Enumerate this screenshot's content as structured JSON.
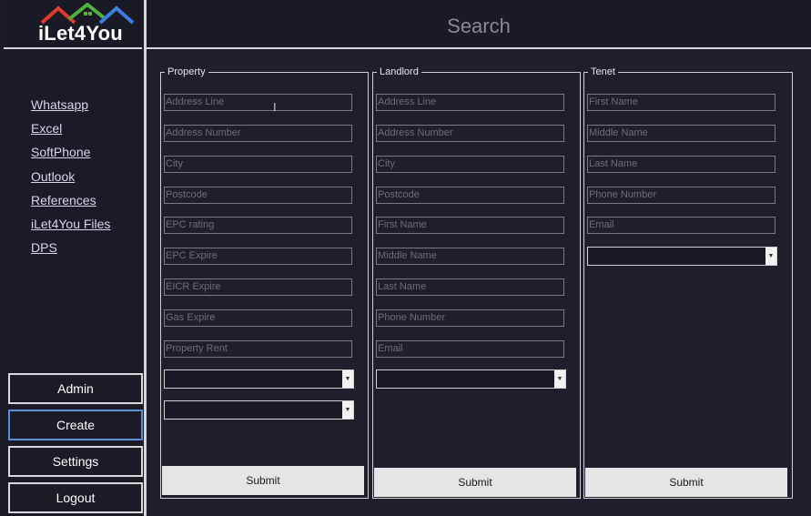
{
  "app": {
    "logo_text": "iLet4You",
    "logo_colors": [
      "#e03a2f",
      "#4fb03a",
      "#3a7fe0"
    ]
  },
  "header": {
    "title": "Search"
  },
  "sidebar": {
    "links": [
      "Whatsapp",
      "Excel",
      "SoftPhone",
      "Outlook",
      "References",
      "iLet4You Files",
      "DPS"
    ],
    "buttons": {
      "admin": "Admin",
      "create": "Create",
      "settings": "Settings",
      "logout": "Logout"
    }
  },
  "property": {
    "title": "Property",
    "fields": {
      "address_line": "Address Line",
      "address_number": "Address Number",
      "city": "City",
      "postcode": "Postcode",
      "epc_rating": "EPC rating",
      "epc_expire": "EPC Expire",
      "eicr_expire": "EICR Expire",
      "gas_expire": "Gas Expire",
      "property_rent": "Property Rent"
    },
    "submit": "Submit"
  },
  "landlord": {
    "title": "Landlord",
    "fields": {
      "address_line": "Address Line",
      "address_number": "Address Number",
      "city": "City",
      "postcode": "Postcode",
      "first_name": "First Name",
      "middle_name": "Middle Name",
      "last_name": "Last Name",
      "phone_number": "Phone Number",
      "email": "Email"
    },
    "submit": "Submit"
  },
  "tenet": {
    "title": "Tenet",
    "fields": {
      "first_name": "First Name",
      "middle_name": "Middle Name",
      "last_name": "Last Name",
      "phone_number": "Phone Number",
      "email": "Email"
    },
    "submit": "Submit"
  },
  "dropdown_arrow": "▼",
  "cursor_glyph": "I"
}
